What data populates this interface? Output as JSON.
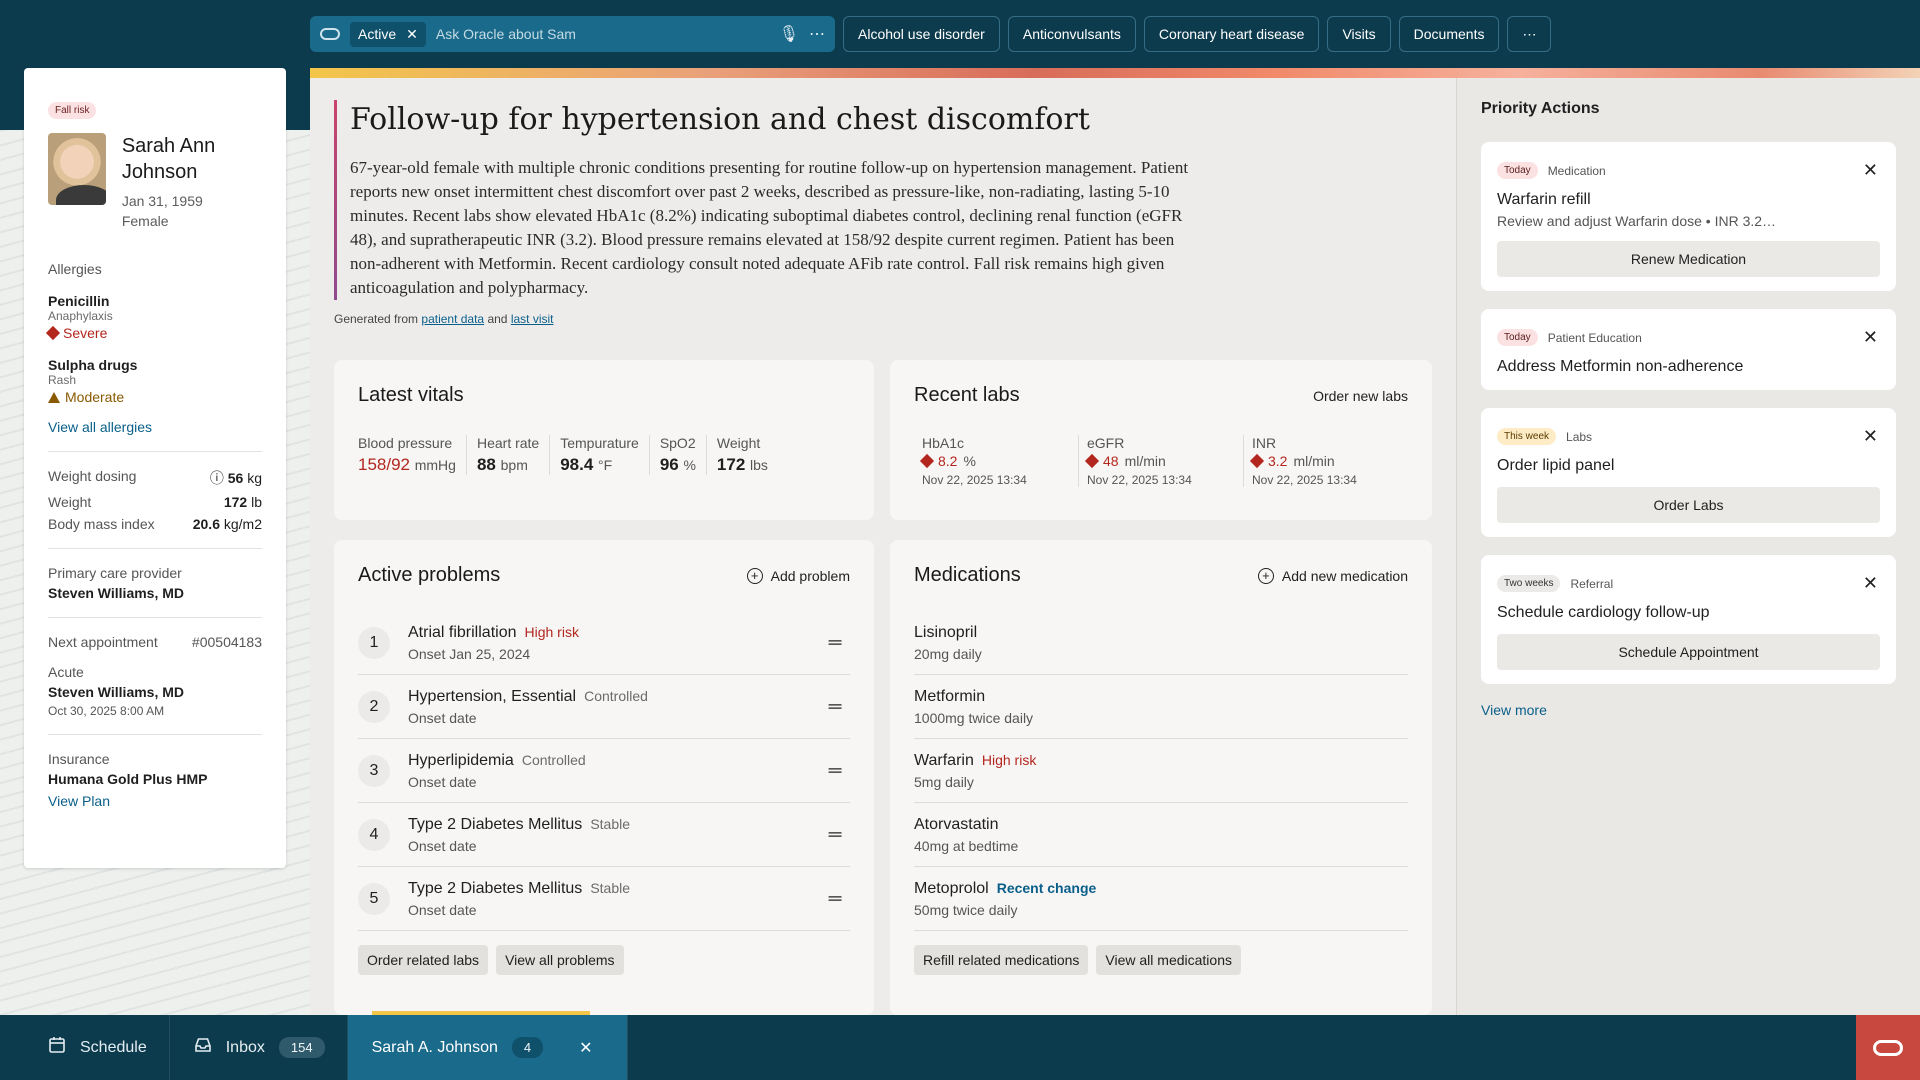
{
  "ask_bar": {
    "active_label": "Active",
    "placeholder": "Ask Oracle about Sam"
  },
  "top_tabs": [
    "Alcohol use disorder",
    "Anticonvulsants",
    "Coronary heart disease",
    "Visits",
    "Documents"
  ],
  "patient": {
    "fall_risk": "Fall risk",
    "name": "Sarah Ann Johnson",
    "dob": "Jan 31, 1959",
    "sex": "Female",
    "allergies_label": "Allergies",
    "allergies": [
      {
        "name": "Penicillin",
        "reaction": "Anaphylaxis",
        "severity": "Severe"
      },
      {
        "name": "Sulpha drugs",
        "reaction": "Rash",
        "severity": "Moderate"
      }
    ],
    "view_all_allergies": "View all allergies",
    "weight_dosing_label": "Weight dosing",
    "weight_dosing_value": "56",
    "weight_dosing_unit": "kg",
    "weight_label": "Weight",
    "weight_value": "172",
    "weight_unit": "lb",
    "bmi_label": "Body mass index",
    "bmi_value": "20.6",
    "bmi_unit": "kg/m2",
    "pcp_label": "Primary care provider",
    "pcp": "Steven Williams, MD",
    "next_appt_label": "Next appointment",
    "next_appt_id": "#00504183",
    "appt_type": "Acute",
    "appt_provider": "Steven Williams, MD",
    "appt_date": "Oct 30, 2025 8:00 AM",
    "insurance_label": "Insurance",
    "insurance": "Humana Gold Plus HMP",
    "view_plan": "View Plan"
  },
  "summary": {
    "title": "Follow-up for hypertension and chest discomfort",
    "body": "67-year-old female with multiple chronic conditions presenting for routine follow-up on hypertension management. Patient reports new onset intermittent chest discomfort over past 2 weeks, described as pressure-like, non-radiating, lasting 5-10 minutes. Recent labs show elevated HbA1c (8.2%) indicating suboptimal diabetes control, declining renal function (eGFR 48), and supratherapeutic INR (3.2). Blood pressure remains elevated at 158/92 despite current regimen. Patient has been non-adherent with Metformin. Recent cardiology consult noted adequate AFib rate control. Fall risk remains high given anticoagulation and polypharmacy.",
    "generated_prefix": "Generated from",
    "link1": "patient data",
    "and": "and",
    "link2": "last visit"
  },
  "vitals": {
    "title": "Latest vitals",
    "items": [
      {
        "label": "Blood pressure",
        "value": "158/92",
        "unit": "mmHg"
      },
      {
        "label": "Heart rate",
        "value": "88",
        "unit": "bpm"
      },
      {
        "label": "Tempurature",
        "value": "98.4",
        "unit": "°F"
      },
      {
        "label": "SpO2",
        "value": "96",
        "unit": "%"
      },
      {
        "label": "Weight",
        "value": "172",
        "unit": "lbs"
      }
    ]
  },
  "labs": {
    "title": "Recent labs",
    "order_btn": "Order new labs",
    "items": [
      {
        "label": "HbA1c",
        "value": "8.2",
        "unit": "%",
        "date": "Nov 22, 2025 13:34"
      },
      {
        "label": "eGFR",
        "value": "48",
        "unit": "ml/min",
        "date": "Nov 22, 2025 13:34"
      },
      {
        "label": "INR",
        "value": "3.2",
        "unit": "ml/min",
        "date": "Nov 22, 2025 13:34"
      }
    ]
  },
  "problems": {
    "title": "Active problems",
    "add_btn": "Add problem",
    "items": [
      {
        "num": "1",
        "name": "Atrial fibrillation",
        "status": "High risk",
        "sub": "Onset Jan 25, 2024"
      },
      {
        "num": "2",
        "name": "Hypertension, Essential",
        "status": "Controlled",
        "sub": "Onset date"
      },
      {
        "num": "3",
        "name": "Hyperlipidemia",
        "status": "Controlled",
        "sub": "Onset date"
      },
      {
        "num": "4",
        "name": "Type 2 Diabetes Mellitus",
        "status": "Stable",
        "sub": "Onset date"
      },
      {
        "num": "5",
        "name": "Type 2 Diabetes Mellitus",
        "status": "Stable",
        "sub": "Onset date"
      }
    ],
    "btn1": "Order related labs",
    "btn2": "View all problems"
  },
  "medications": {
    "title": "Medications",
    "add_btn": "Add new medication",
    "items": [
      {
        "name": "Lisinopril",
        "status": "",
        "dose": "20mg daily"
      },
      {
        "name": "Metformin",
        "status": "",
        "dose": "1000mg twice daily"
      },
      {
        "name": "Warfarin",
        "status": "High risk",
        "dose": "5mg daily"
      },
      {
        "name": "Atorvastatin",
        "status": "",
        "dose": "40mg at bedtime"
      },
      {
        "name": "Metoprolol",
        "status": "Recent change",
        "dose": "50mg twice daily"
      }
    ],
    "btn1": "Refill related medications",
    "btn2": "View all medications"
  },
  "priority": {
    "title": "Priority Actions",
    "cards": [
      {
        "tag": "Today",
        "category": "Medication",
        "title": "Warfarin refill",
        "desc": "Review and adjust Warfarin dose • INR 3.2…",
        "button": "Renew Medication"
      },
      {
        "tag": "Today",
        "category": "Patient Education",
        "title": "Address Metformin non-adherence",
        "desc": "",
        "button": ""
      },
      {
        "tag": "This week",
        "category": "Labs",
        "title": "Order lipid panel",
        "desc": "",
        "button": "Order Labs"
      },
      {
        "tag": "Two weeks",
        "category": "Referral",
        "title": "Schedule cardiology follow-up",
        "desc": "",
        "button": "Schedule Appointment"
      }
    ],
    "view_more": "View more"
  },
  "taskbar": {
    "schedule": "Schedule",
    "inbox": "Inbox",
    "inbox_count": "154",
    "patient_tab": "Sarah A. Johnson",
    "patient_count": "4"
  }
}
